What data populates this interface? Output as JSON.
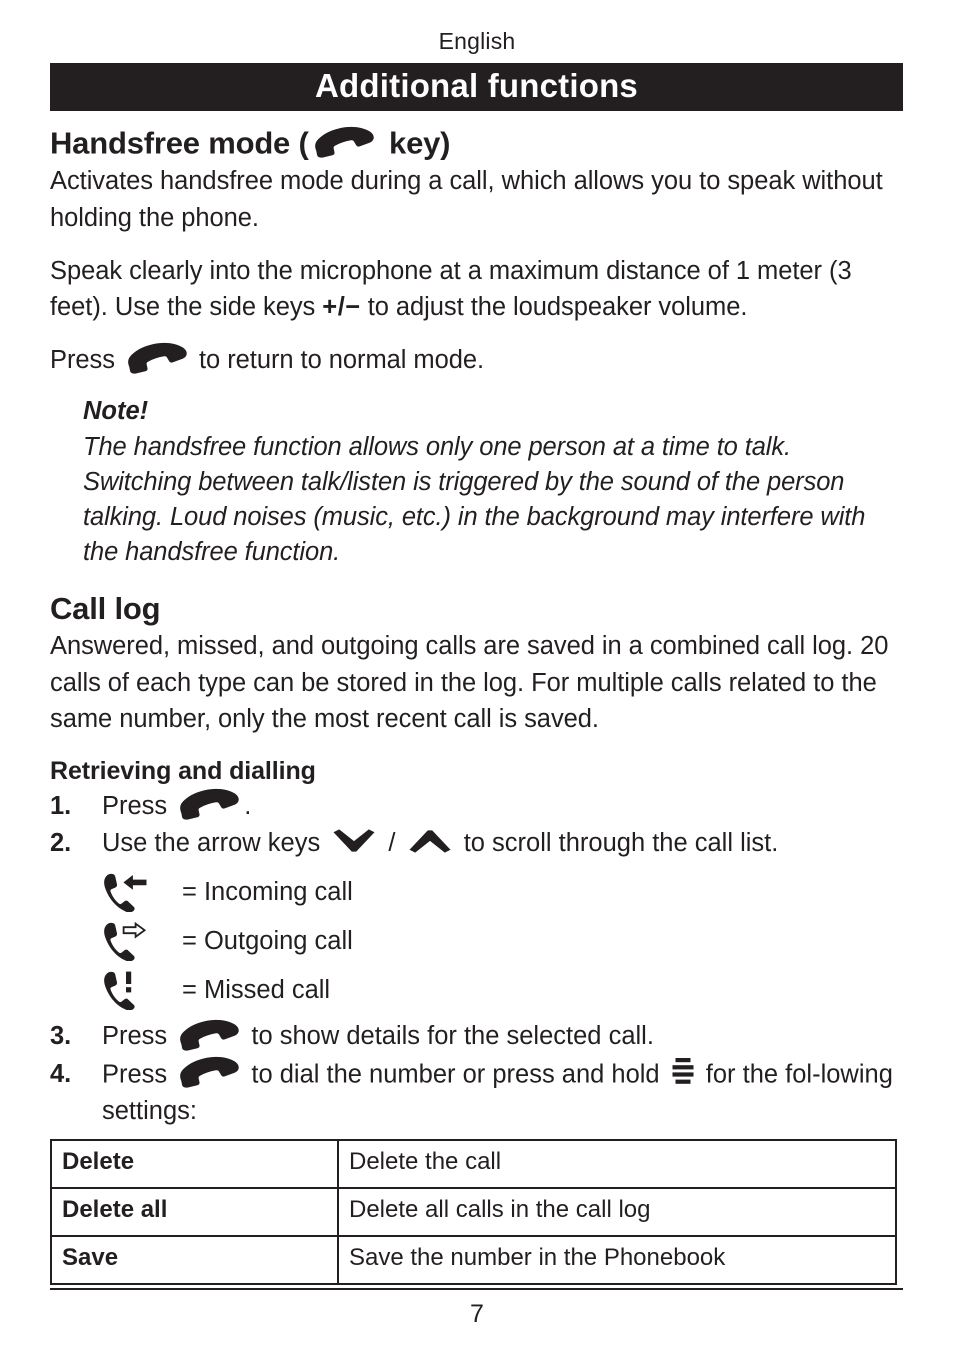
{
  "document": {
    "running_head": "English",
    "chapter_title": "Additional functions",
    "page_number": "7"
  },
  "sections": [
    {
      "id": "handsfree",
      "heading_before_icon": "Handsfree mode (",
      "heading_icon": "handset-icon",
      "heading_after_icon": " key)",
      "paragraphs": [
        "Activates handsfree mode during a call, which allows you to speak without holding the phone.",
        "Speak clearly into the microphone at a maximum distance of 1 meter (3 feet). Use the side keys +/− to adjust the loudspeaker volume."
      ],
      "paragraph_split": {
        "p2_before_keys": "Speak clearly into the microphone at a maximum distance of 1 meter (3 feet). Use the side keys ",
        "p2_keys": "+/−",
        "p2_after_keys": " to adjust the loudspeaker volume."
      },
      "press_line": {
        "before_icon": "Press ",
        "icon": "handset-icon",
        "after_icon": " to return to normal mode."
      },
      "note": {
        "title": "Note!",
        "body": "The handsfree function allows only one person at a time to talk. Switching between talk/listen is triggered by the sound of the person talking. Loud noises (music, etc.) in the background may interfere with the handsfree function."
      }
    },
    {
      "id": "call-log",
      "heading": "Call log",
      "paragraphs": [
        "Answered, missed, and outgoing calls are saved in a combined call log. 20 calls of each type can be stored in the log. For multiple calls related to the same number, only the most recent call is saved."
      ],
      "sub_heading": "Retrieving and dialling"
    }
  ],
  "steps": [
    {
      "number": "1.",
      "before_icon": "Press ",
      "icon": "handset-icon",
      "after_icon": "."
    },
    {
      "number": "2.",
      "before_icon": "Use the arrow keys ",
      "icon": "chevron-down-icon",
      "separator": " / ",
      "icon2": "chevron-up-icon",
      "after_icon": " to scroll through the call list."
    },
    {
      "number": "3.",
      "before_icon": "Press ",
      "icon": "handset-icon",
      "after_icon": " to show details for the selected call."
    },
    {
      "number": "4.",
      "before_icon": "Press ",
      "icon": "handset-icon",
      "mid_text": " to dial the number or press and hold ",
      "icon2": "menu-icon",
      "after_icon": " for the fol-lowing settings:"
    }
  ],
  "call_type_legend": [
    {
      "icon": "incoming-call-icon",
      "label": "= Incoming call"
    },
    {
      "icon": "outgoing-call-icon",
      "label": "= Outgoing call"
    },
    {
      "icon": "missed-call-icon",
      "label": "= Missed call"
    }
  ],
  "settings_table": {
    "rows": [
      {
        "key": "Delete",
        "description": "Delete the call"
      },
      {
        "key": "Delete all",
        "description": "Delete all calls in the call log"
      },
      {
        "key": "Save",
        "description": "Save the number in the Phonebook"
      }
    ]
  },
  "colors": {
    "ink": "#231f20",
    "paper": "#ffffff",
    "bar_background": "#231f20",
    "bar_text": "#ffffff"
  }
}
